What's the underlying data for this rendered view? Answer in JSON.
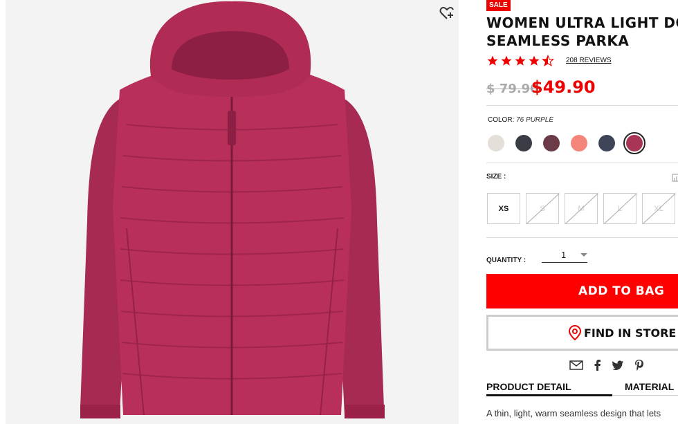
{
  "product": {
    "sale_badge": "SALE",
    "title_line1": "WOMEN ULTRA LIGHT DOWN",
    "title_line2": "SEAMLESS PARKA",
    "rating": 4.5,
    "reviews": "208 REVIEWS",
    "price_old": "$ 79.90",
    "price_new": "$49.90"
  },
  "color": {
    "label": "COLOR:",
    "selected": "76 PURPLE",
    "swatches": [
      "#e4dfd9",
      "#3a3d45",
      "#6b3b47",
      "#f4857a",
      "#3f4558",
      "#a83555"
    ]
  },
  "size": {
    "label": "SIZE :",
    "options": [
      "XS",
      "S",
      "M",
      "L",
      "XL"
    ],
    "available": [
      true,
      false,
      false,
      false,
      false
    ]
  },
  "quantity": {
    "label": "QUANTITY :",
    "value": "1"
  },
  "buttons": {
    "add_to_bag": "ADD TO BAG",
    "find_in_store": "FIND IN STORE"
  },
  "tabs": [
    "PRODUCT DETAIL",
    "MATERIAL"
  ],
  "description": "A thin, light, warm seamless design that lets",
  "colors": {
    "accent": "#ff0000",
    "jacket": "#b8305a"
  }
}
